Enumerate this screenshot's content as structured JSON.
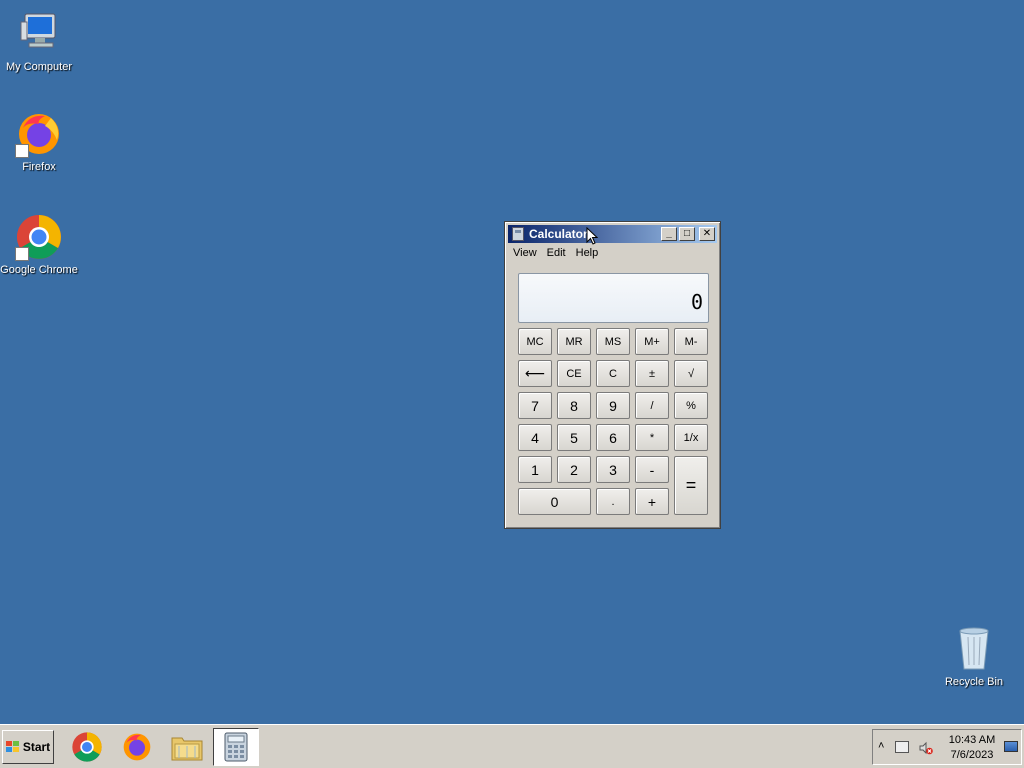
{
  "desktop": {
    "icons": [
      {
        "label": "My Computer",
        "icon": "computer-icon"
      },
      {
        "label": "Firefox",
        "icon": "firefox-icon"
      },
      {
        "label": "Google Chrome",
        "icon": "chrome-icon"
      },
      {
        "label": "Recycle Bin",
        "icon": "recycle-bin-icon"
      }
    ]
  },
  "calculator": {
    "title": "Calculator",
    "menu": [
      "View",
      "Edit",
      "Help"
    ],
    "display": "0",
    "buttons": {
      "mc": "MC",
      "mr": "MR",
      "ms": "MS",
      "mplus": "M+",
      "mminus": "M-",
      "back": "⟵",
      "ce": "CE",
      "c": "C",
      "plusminus": "±",
      "sqrt": "√",
      "seven": "7",
      "eight": "8",
      "nine": "9",
      "div": "/",
      "percent": "%",
      "four": "4",
      "five": "5",
      "six": "6",
      "mul": "*",
      "recip": "1/x",
      "one": "1",
      "two": "2",
      "three": "3",
      "minus": "-",
      "equals": "=",
      "zero": "0",
      "dot": ".",
      "plus": "+"
    },
    "titlebar_buttons": {
      "minimize": "_",
      "maximize": "□",
      "close": "✕"
    }
  },
  "taskbar": {
    "start_label": "Start",
    "apps": [
      {
        "name": "Google Chrome",
        "icon": "chrome-icon"
      },
      {
        "name": "Firefox",
        "icon": "firefox-icon"
      },
      {
        "name": "Windows Explorer",
        "icon": "folder-icon"
      },
      {
        "name": "Calculator",
        "icon": "calculator-icon",
        "active": true
      }
    ],
    "tray": {
      "expand": "˄",
      "time": "10:43 AM",
      "date": "7/6/2023"
    }
  },
  "colors": {
    "desktop": "#3a6ea5",
    "titlebar_start": "#0a246a",
    "titlebar_end": "#a6caf0"
  }
}
